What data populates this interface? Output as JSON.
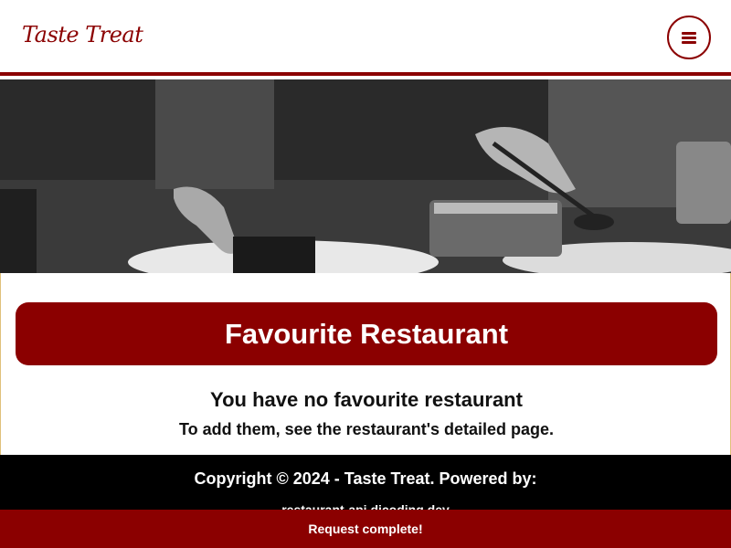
{
  "header": {
    "logo_text": "Taste Treat",
    "menu_icon": "hamburger-menu-icon",
    "accent_color": "#8b0000"
  },
  "hero": {
    "image_subject": "chefs plating food in a kitchen"
  },
  "main": {
    "title": "Favourite Restaurant",
    "empty_title": "You have no favourite restaurant",
    "empty_subtitle": "To add them, see the restaurant's detailed page."
  },
  "footer": {
    "copyright": "Copyright © 2024 - Taste Treat. Powered by:",
    "powered_by": "restaurant-api.dicoding.dev"
  },
  "toast": {
    "message": "Request complete!"
  }
}
